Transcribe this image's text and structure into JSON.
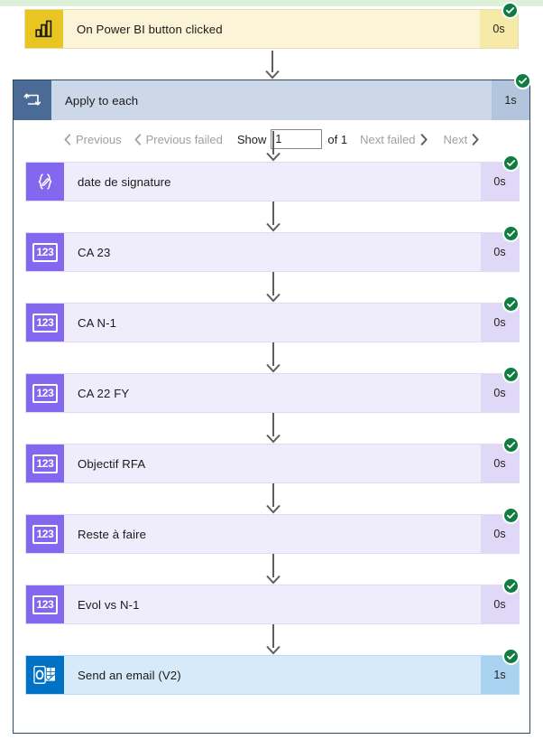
{
  "page": {
    "background": "#ffffff",
    "top_band_color": "#ddf0d8"
  },
  "trigger": {
    "title": "On Power BI button clicked",
    "duration": "0s",
    "status": "succeeded",
    "icon": "power-bi-icon",
    "accent": "#e8c520"
  },
  "loop": {
    "title": "Apply to each",
    "duration": "1s",
    "status": "succeeded",
    "icon": "loop-icon",
    "accent": "#4a6b96",
    "pager": {
      "previous_label": "Previous",
      "previous_failed_label": "Previous failed",
      "show_label": "Show",
      "show_value": "1",
      "show_placeholder": "1",
      "of_label": "of 1",
      "next_failed_label": "Next failed",
      "next_label": "Next"
    }
  },
  "actions": [
    {
      "title": "date de signature",
      "duration": "0s",
      "status": "succeeded",
      "icon": "compose-expression-icon",
      "theme": "purple"
    },
    {
      "title": "CA 23",
      "duration": "0s",
      "status": "succeeded",
      "icon": "variable-123-icon",
      "theme": "purple"
    },
    {
      "title": "CA N-1",
      "duration": "0s",
      "status": "succeeded",
      "icon": "variable-123-icon",
      "theme": "purple"
    },
    {
      "title": "CA 22 FY",
      "duration": "0s",
      "status": "succeeded",
      "icon": "variable-123-icon",
      "theme": "purple"
    },
    {
      "title": "Objectif RFA",
      "duration": "0s",
      "status": "succeeded",
      "icon": "variable-123-icon",
      "theme": "purple"
    },
    {
      "title": "Reste à faire",
      "duration": "0s",
      "status": "succeeded",
      "icon": "variable-123-icon",
      "theme": "purple"
    },
    {
      "title": "Evol vs N-1",
      "duration": "0s",
      "status": "succeeded",
      "icon": "variable-123-icon",
      "theme": "purple"
    },
    {
      "title": "Send an email (V2)",
      "duration": "1s",
      "status": "succeeded",
      "icon": "outlook-icon",
      "theme": "blue"
    }
  ],
  "icon_glyphs": {
    "variable": "123"
  }
}
